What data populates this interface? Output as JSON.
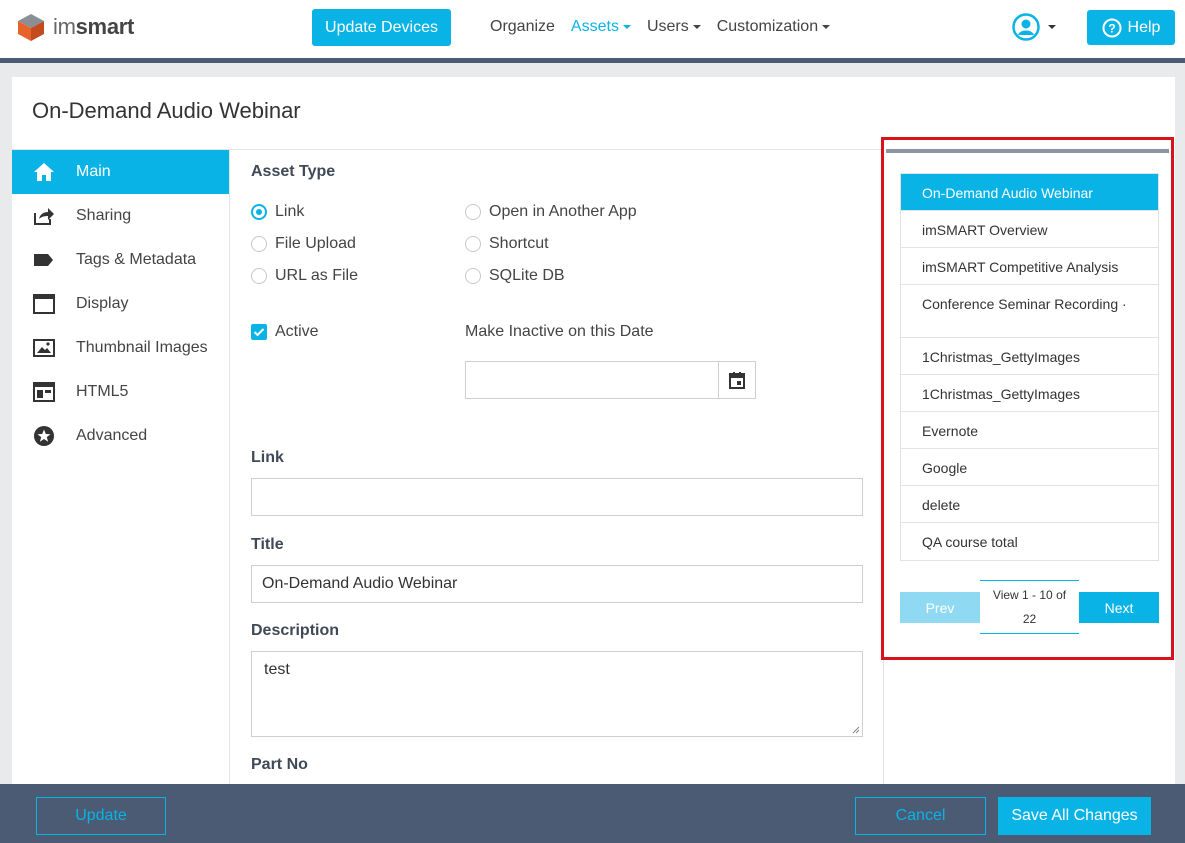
{
  "brand": {
    "logo_thin": "im",
    "logo_bold": "smart"
  },
  "header": {
    "update_devices": "Update Devices",
    "nav": [
      {
        "label": "Organize",
        "dropdown": false,
        "active": false
      },
      {
        "label": "Assets",
        "dropdown": true,
        "active": true
      },
      {
        "label": "Users",
        "dropdown": true,
        "active": false
      },
      {
        "label": "Customization",
        "dropdown": true,
        "active": false
      }
    ],
    "help": "Help"
  },
  "page": {
    "title": "On-Demand Audio Webinar"
  },
  "sidebar": {
    "items": [
      {
        "label": "Main",
        "icon": "home-icon",
        "active": true
      },
      {
        "label": "Sharing",
        "icon": "share-icon",
        "active": false
      },
      {
        "label": "Tags & Metadata",
        "icon": "tag-icon",
        "active": false
      },
      {
        "label": "Display",
        "icon": "display-icon",
        "active": false
      },
      {
        "label": "Thumbnail Images",
        "icon": "image-icon",
        "active": false
      },
      {
        "label": "HTML5",
        "icon": "html5-icon",
        "active": false
      },
      {
        "label": "Advanced",
        "icon": "star-icon",
        "active": false
      }
    ]
  },
  "form": {
    "asset_type_label": "Asset Type",
    "asset_types": [
      {
        "label": "Link",
        "checked": true
      },
      {
        "label": "File Upload",
        "checked": false
      },
      {
        "label": "URL as File",
        "checked": false
      },
      {
        "label": "Open in Another App",
        "checked": false
      },
      {
        "label": "Shortcut",
        "checked": false
      },
      {
        "label": "SQLite DB",
        "checked": false
      }
    ],
    "active_label": "Active",
    "active_checked": true,
    "inactive_date_label": "Make Inactive on this Date",
    "inactive_date_value": "",
    "link_label": "Link",
    "link_value": "",
    "title_label": "Title",
    "title_value": "On-Demand Audio Webinar",
    "description_label": "Description",
    "description_value": "test",
    "part_no_label": "Part No"
  },
  "asset_list": {
    "items": [
      {
        "label": "On-Demand Audio Webinar",
        "active": true
      },
      {
        "label": "imSMART Overview",
        "active": false
      },
      {
        "label": "imSMART Competitive Analysis",
        "active": false
      },
      {
        "label": "Conference Seminar Recording ·",
        "active": false
      },
      {
        "label": "1Christmas_GettyImages",
        "active": false
      },
      {
        "label": "1Christmas_GettyImages",
        "active": false
      },
      {
        "label": "Evernote",
        "active": false
      },
      {
        "label": "Google",
        "active": false
      },
      {
        "label": "delete",
        "active": false
      },
      {
        "label": "QA course total",
        "active": false
      }
    ],
    "prev": "Prev",
    "next": "Next",
    "view_line1": "View 1 - 10 of",
    "view_line2": "22"
  },
  "footer": {
    "update": "Update",
    "cancel": "Cancel",
    "save_all": "Save All Changes"
  },
  "colors": {
    "accent": "#09b3e6",
    "footer_bg": "#4a5b73",
    "highlight_frame": "#d7141c"
  }
}
